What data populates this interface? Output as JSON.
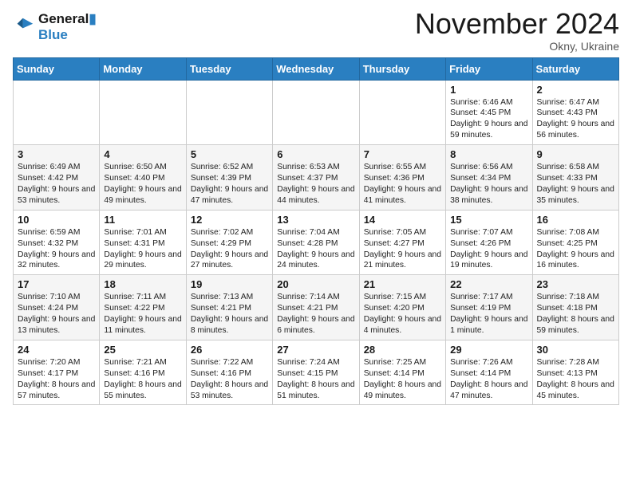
{
  "header": {
    "logo_line1": "General",
    "logo_line2": "Blue",
    "month": "November 2024",
    "location": "Okny, Ukraine"
  },
  "weekdays": [
    "Sunday",
    "Monday",
    "Tuesday",
    "Wednesday",
    "Thursday",
    "Friday",
    "Saturday"
  ],
  "weeks": [
    [
      {
        "day": "",
        "info": ""
      },
      {
        "day": "",
        "info": ""
      },
      {
        "day": "",
        "info": ""
      },
      {
        "day": "",
        "info": ""
      },
      {
        "day": "",
        "info": ""
      },
      {
        "day": "1",
        "info": "Sunrise: 6:46 AM\nSunset: 4:45 PM\nDaylight: 9 hours and 59 minutes."
      },
      {
        "day": "2",
        "info": "Sunrise: 6:47 AM\nSunset: 4:43 PM\nDaylight: 9 hours and 56 minutes."
      }
    ],
    [
      {
        "day": "3",
        "info": "Sunrise: 6:49 AM\nSunset: 4:42 PM\nDaylight: 9 hours and 53 minutes."
      },
      {
        "day": "4",
        "info": "Sunrise: 6:50 AM\nSunset: 4:40 PM\nDaylight: 9 hours and 49 minutes."
      },
      {
        "day": "5",
        "info": "Sunrise: 6:52 AM\nSunset: 4:39 PM\nDaylight: 9 hours and 47 minutes."
      },
      {
        "day": "6",
        "info": "Sunrise: 6:53 AM\nSunset: 4:37 PM\nDaylight: 9 hours and 44 minutes."
      },
      {
        "day": "7",
        "info": "Sunrise: 6:55 AM\nSunset: 4:36 PM\nDaylight: 9 hours and 41 minutes."
      },
      {
        "day": "8",
        "info": "Sunrise: 6:56 AM\nSunset: 4:34 PM\nDaylight: 9 hours and 38 minutes."
      },
      {
        "day": "9",
        "info": "Sunrise: 6:58 AM\nSunset: 4:33 PM\nDaylight: 9 hours and 35 minutes."
      }
    ],
    [
      {
        "day": "10",
        "info": "Sunrise: 6:59 AM\nSunset: 4:32 PM\nDaylight: 9 hours and 32 minutes."
      },
      {
        "day": "11",
        "info": "Sunrise: 7:01 AM\nSunset: 4:31 PM\nDaylight: 9 hours and 29 minutes."
      },
      {
        "day": "12",
        "info": "Sunrise: 7:02 AM\nSunset: 4:29 PM\nDaylight: 9 hours and 27 minutes."
      },
      {
        "day": "13",
        "info": "Sunrise: 7:04 AM\nSunset: 4:28 PM\nDaylight: 9 hours and 24 minutes."
      },
      {
        "day": "14",
        "info": "Sunrise: 7:05 AM\nSunset: 4:27 PM\nDaylight: 9 hours and 21 minutes."
      },
      {
        "day": "15",
        "info": "Sunrise: 7:07 AM\nSunset: 4:26 PM\nDaylight: 9 hours and 19 minutes."
      },
      {
        "day": "16",
        "info": "Sunrise: 7:08 AM\nSunset: 4:25 PM\nDaylight: 9 hours and 16 minutes."
      }
    ],
    [
      {
        "day": "17",
        "info": "Sunrise: 7:10 AM\nSunset: 4:24 PM\nDaylight: 9 hours and 13 minutes."
      },
      {
        "day": "18",
        "info": "Sunrise: 7:11 AM\nSunset: 4:22 PM\nDaylight: 9 hours and 11 minutes."
      },
      {
        "day": "19",
        "info": "Sunrise: 7:13 AM\nSunset: 4:21 PM\nDaylight: 9 hours and 8 minutes."
      },
      {
        "day": "20",
        "info": "Sunrise: 7:14 AM\nSunset: 4:21 PM\nDaylight: 9 hours and 6 minutes."
      },
      {
        "day": "21",
        "info": "Sunrise: 7:15 AM\nSunset: 4:20 PM\nDaylight: 9 hours and 4 minutes."
      },
      {
        "day": "22",
        "info": "Sunrise: 7:17 AM\nSunset: 4:19 PM\nDaylight: 9 hours and 1 minute."
      },
      {
        "day": "23",
        "info": "Sunrise: 7:18 AM\nSunset: 4:18 PM\nDaylight: 8 hours and 59 minutes."
      }
    ],
    [
      {
        "day": "24",
        "info": "Sunrise: 7:20 AM\nSunset: 4:17 PM\nDaylight: 8 hours and 57 minutes."
      },
      {
        "day": "25",
        "info": "Sunrise: 7:21 AM\nSunset: 4:16 PM\nDaylight: 8 hours and 55 minutes."
      },
      {
        "day": "26",
        "info": "Sunrise: 7:22 AM\nSunset: 4:16 PM\nDaylight: 8 hours and 53 minutes."
      },
      {
        "day": "27",
        "info": "Sunrise: 7:24 AM\nSunset: 4:15 PM\nDaylight: 8 hours and 51 minutes."
      },
      {
        "day": "28",
        "info": "Sunrise: 7:25 AM\nSunset: 4:14 PM\nDaylight: 8 hours and 49 minutes."
      },
      {
        "day": "29",
        "info": "Sunrise: 7:26 AM\nSunset: 4:14 PM\nDaylight: 8 hours and 47 minutes."
      },
      {
        "day": "30",
        "info": "Sunrise: 7:28 AM\nSunset: 4:13 PM\nDaylight: 8 hours and 45 minutes."
      }
    ]
  ]
}
